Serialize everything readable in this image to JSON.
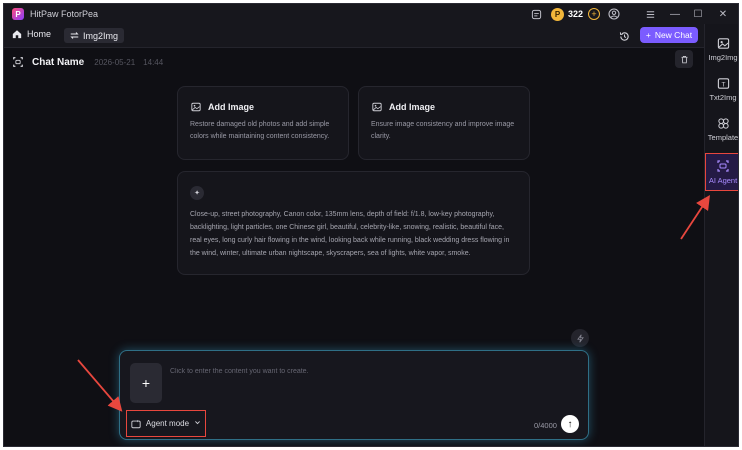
{
  "window": {
    "app_title": "HitPaw FotorPea",
    "logo_letter": "P",
    "credits": "322",
    "coin_symbol": "P",
    "controls": {
      "minimize": "—",
      "maximize": "☐",
      "close": "✕"
    }
  },
  "tabs": {
    "home_label": "Home",
    "active_label": "Img2Img"
  },
  "toolbar": {
    "new_chat_label": "New Chat"
  },
  "sidebar": {
    "items": [
      {
        "label": "Img2Img",
        "icon": "image-icon"
      },
      {
        "label": "Txt2Img",
        "icon": "text-image-icon"
      },
      {
        "label": "Template",
        "icon": "template-icon"
      },
      {
        "label": "AI Agent",
        "icon": "agent-icon",
        "active": true
      }
    ]
  },
  "chat": {
    "name": "Chat Name",
    "date": "2026-05-21",
    "time": "14:44"
  },
  "cards": [
    {
      "title": "Add Image",
      "description": "Restore damaged old photos and add simple colors while maintaining content consistency."
    },
    {
      "title": "Add Image",
      "description": "Ensure image consistency and improve image clarity."
    }
  ],
  "prompt_card": {
    "text": "Close-up, street photography, Canon color, 135mm lens, depth of field: f/1.8, low-key photography, backlighting, light particles, one Chinese girl, beautiful, celebrity-like, snowing, realistic, beautiful face, real eyes, long curly hair flowing in the wind, looking back while running, black wedding dress flowing in the wind, winter, ultimate urban nightscape, skyscrapers, sea of lights, white vapor, smoke."
  },
  "composer": {
    "placeholder": "Click to enter the content you want to create.",
    "value": "",
    "upload_symbol": "+",
    "mode_label": "Agent mode",
    "char_count": "0/4000",
    "send_symbol": "↑"
  },
  "colors": {
    "accent": "#7b5cff",
    "annotation": "#e8473e",
    "glow": "#2f6f86",
    "coin": "#f2b63a"
  }
}
